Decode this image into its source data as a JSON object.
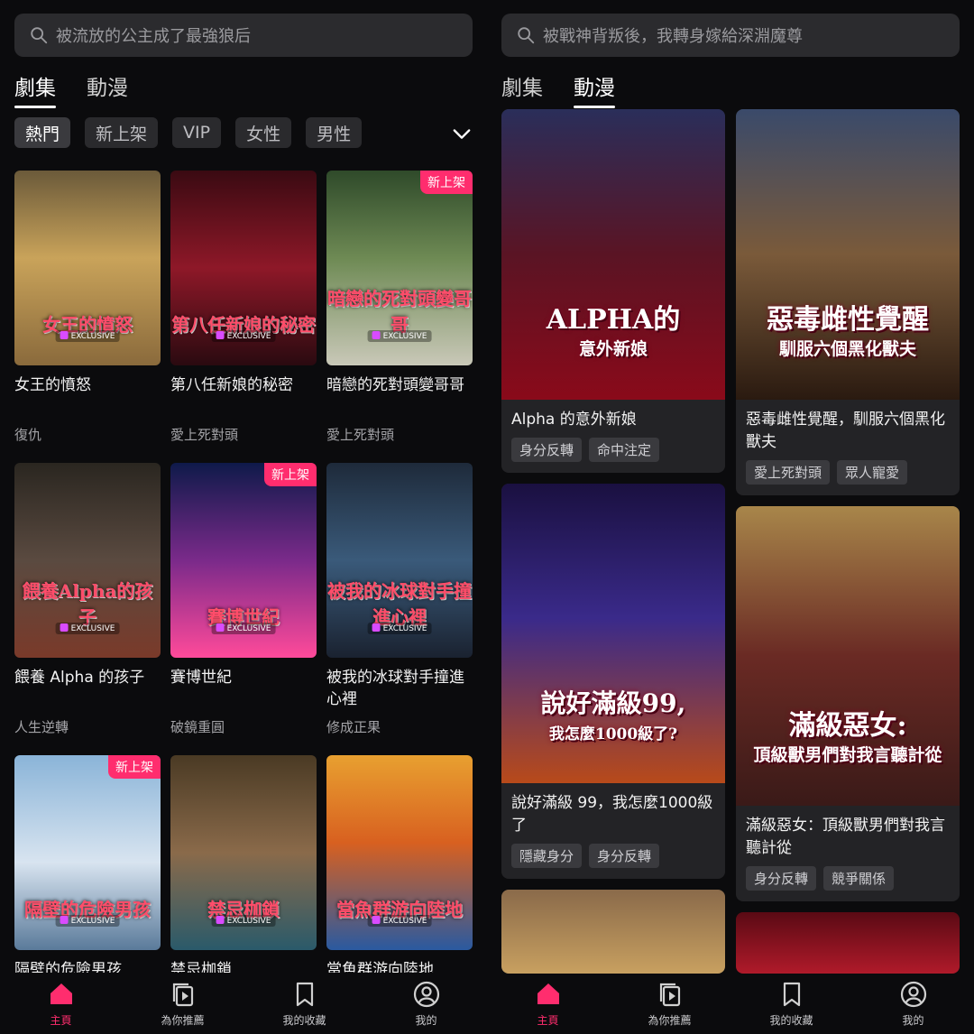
{
  "left": {
    "search_placeholder": "被流放的公主成了最強狼后",
    "tabs": [
      "劇集",
      "動漫"
    ],
    "active_tab": 0,
    "chips": [
      "熱門",
      "新上架",
      "VIP",
      "女性",
      "男性"
    ],
    "cards": [
      {
        "name": "女王的憤怒",
        "genre": "復仇",
        "poster_title": "女王的憤怒",
        "new": false
      },
      {
        "name": "第八任新娘的秘密",
        "genre": "愛上死對頭",
        "poster_title": "第八任新娘的秘密",
        "new": false
      },
      {
        "name": "暗戀的死對頭變哥哥",
        "genre": "愛上死對頭",
        "poster_title": "暗戀的死對頭變哥哥",
        "new": true
      },
      {
        "name": "餵養 Alpha 的孩子",
        "genre": "人生逆轉",
        "poster_title": "餵養Alpha的孩子",
        "new": false
      },
      {
        "name": "賽博世紀",
        "genre": "破鏡重圓",
        "poster_title": "賽博世紀",
        "new": true
      },
      {
        "name": "被我的冰球對手撞進心裡",
        "genre": "修成正果",
        "poster_title": "被我的冰球對手撞進心裡",
        "new": false
      },
      {
        "name": "隔壁的危險男孩",
        "genre": "",
        "poster_title": "隔壁的危險男孩",
        "new": true
      },
      {
        "name": "禁忌枷鎖",
        "genre": "",
        "poster_title": "禁忌枷鎖",
        "new": false
      },
      {
        "name": "當魚群游向陸地",
        "genre": "",
        "poster_title": "當魚群游向陸地",
        "new": false
      }
    ]
  },
  "right": {
    "search_placeholder": "被戰神背叛後，我轉身嫁給深淵魔尊",
    "tabs": [
      "劇集",
      "動漫"
    ],
    "active_tab": 1,
    "cards": [
      {
        "name": "Alpha 的意外新娘",
        "tags": [
          "身分反轉",
          "命中注定"
        ],
        "poster_title": "ALPHA的",
        "poster_sub": "意外新娘"
      },
      {
        "name": "惡毒雌性覺醒，馴服六個黑化獸夫",
        "tags": [
          "愛上死對頭",
          "眾人寵愛"
        ],
        "poster_title": "惡毒雌性覺醒",
        "poster_sub": "馴服六個黑化獸夫"
      },
      {
        "name": "說好滿級 99，我怎麼1000級了",
        "tags": [
          "隱藏身分",
          "身分反轉"
        ],
        "poster_title": "說好滿級99,",
        "poster_sub": "我怎麼1000級了?"
      },
      {
        "name": "滿級惡女：頂級獸男們對我言聽計從",
        "tags": [
          "身分反轉",
          "競爭關係"
        ],
        "poster_title": "滿級惡女:",
        "poster_sub": "頂級獸男們對我言聽計從"
      }
    ]
  },
  "excl_label": "EXCLUSIVE",
  "new_badge": "新上架",
  "nav": [
    "主頁",
    "為你推薦",
    "我的收藏",
    "我的"
  ],
  "colors": {
    "accent": "#ff2d6e",
    "bg": "#0b0b0d",
    "chip": "#2a2a2d"
  }
}
